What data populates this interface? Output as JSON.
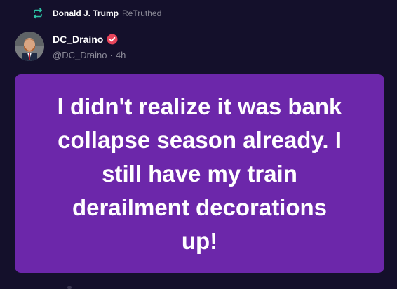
{
  "retruth": {
    "icon": "retruth-icon",
    "user_name": "Donald J. Trump",
    "label": "ReTruthed"
  },
  "author": {
    "display_name": "DC_Draino",
    "handle": "@DC_Draino",
    "separator": "·",
    "time_ago": "4h",
    "verified_icon": "verified-badge-icon"
  },
  "post": {
    "text": "I didn't realize it was bank collapse season already. I still have my train derailment decorations up!",
    "card_color": "#6c27aa"
  },
  "colors": {
    "background": "#14102b",
    "accent_green": "#2ec4a6",
    "verified_red": "#e8455b",
    "muted_text": "#8b8a97"
  }
}
